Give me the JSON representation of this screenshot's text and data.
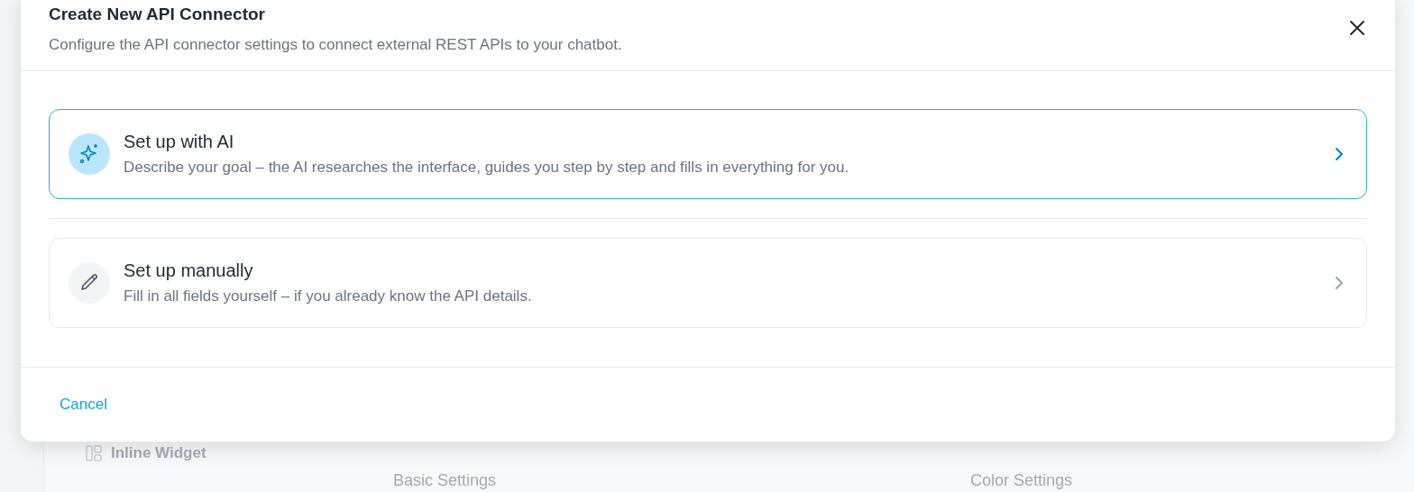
{
  "background": {
    "sidebar_item": "Inline Widget",
    "section_headings": [
      "Basic Settings",
      "Color Settings"
    ]
  },
  "dialog": {
    "title": "Create New API Connector",
    "subtitle": "Configure the API connector settings to connect external REST APIs to your chatbot.",
    "options": [
      {
        "kind": "ai",
        "title": "Set up with AI",
        "description": "Describe your goal – the AI researches the interface, guides you step by step and fills in everything for you.",
        "selected": true
      },
      {
        "kind": "manual",
        "title": "Set up manually",
        "description": "Fill in all fields yourself – if you already know the API details.",
        "selected": false
      }
    ],
    "cancel_button": "Cancel"
  }
}
